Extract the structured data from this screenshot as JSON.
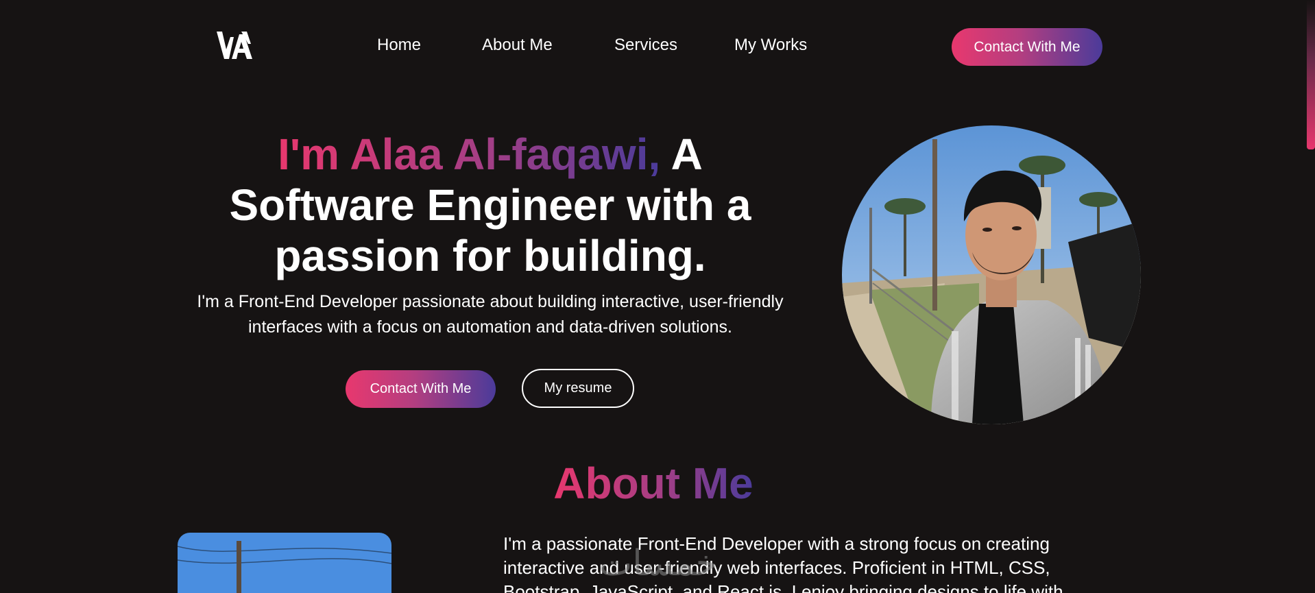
{
  "nav": {
    "logo_text": "WA",
    "links": [
      {
        "label": "Home"
      },
      {
        "label": "About Me"
      },
      {
        "label": "Services"
      },
      {
        "label": "My Works"
      }
    ],
    "cta_label": "Contact With Me"
  },
  "hero": {
    "name_part": "I'm Alaa Al-faqawi,",
    "title_rest_1": " A",
    "title_rest_2": "Software Engineer with a",
    "title_rest_3": "passion for building.",
    "description": "I'm a Front-End Developer passionate about building interactive, user-friendly interfaces with a focus on automation and data-driven solutions.",
    "primary_button": "Contact With Me",
    "secondary_button": "My resume"
  },
  "about": {
    "title": "About Me",
    "text": "I'm a passionate Front-End Developer with a strong focus on creating interactive and user-friendly web interfaces. Proficient in HTML, CSS, Bootstrap, JavaScript, and React.js, I enjoy bringing designs to life with"
  },
  "watermark": {
    "text": "خمسات"
  },
  "colors": {
    "background": "#161313",
    "accent_start": "#e8386e",
    "accent_end": "#4b3b9a",
    "text": "#ffffff"
  },
  "icons": {
    "logo": "wa-monogram-logo"
  }
}
